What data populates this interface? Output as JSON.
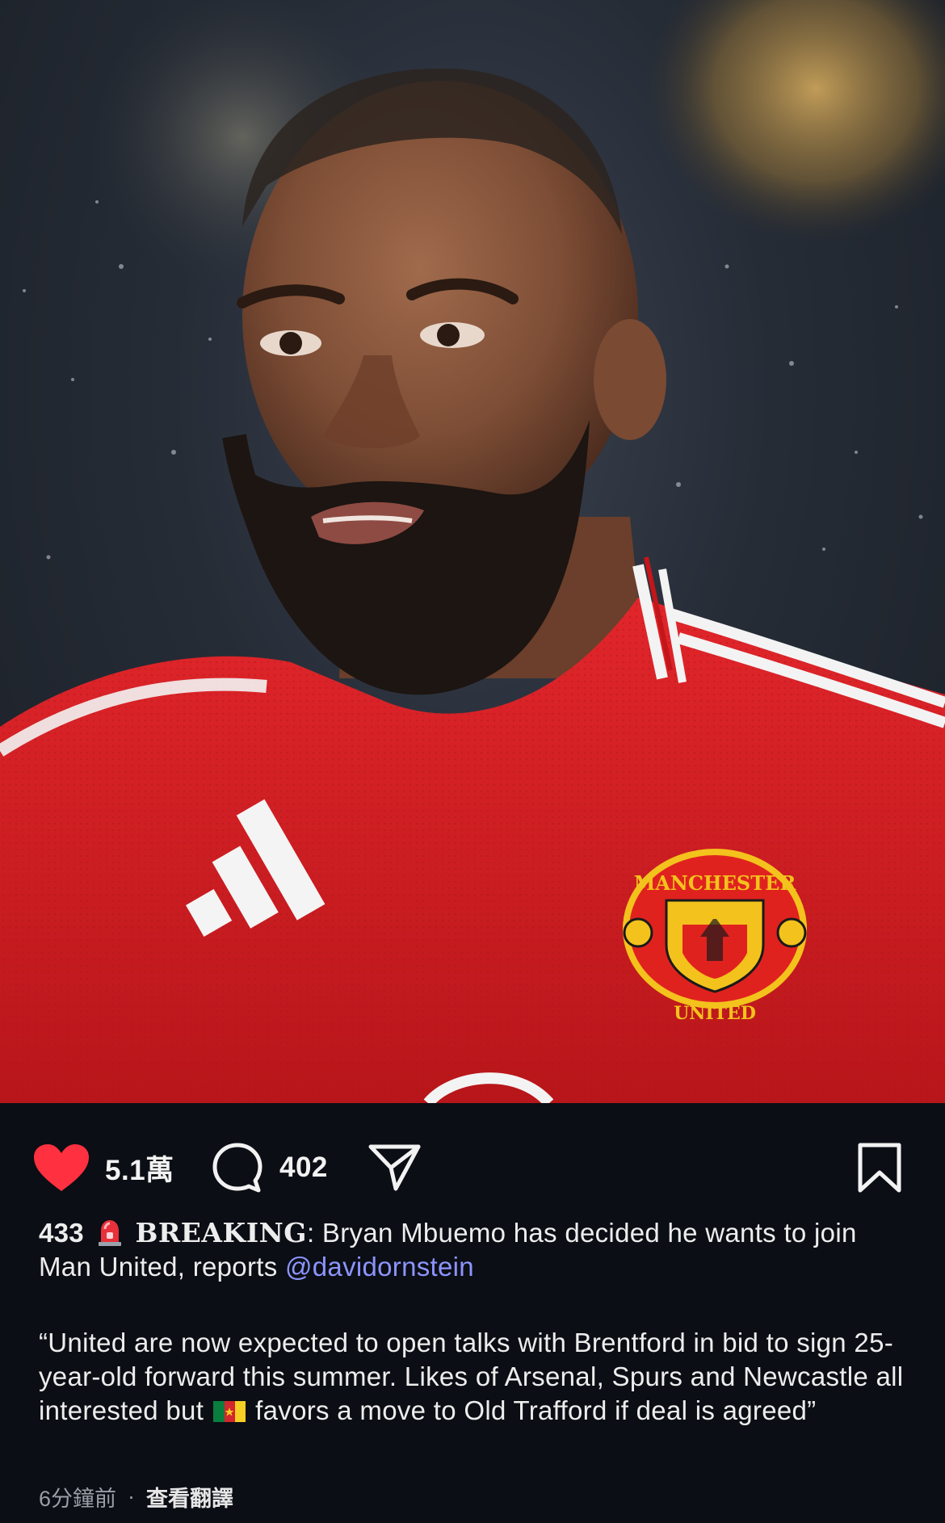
{
  "post": {
    "username": "433",
    "headline": "BREAKING",
    "caption_after_headline": ": Bryan Mbuemo has decided he wants to join Man United, reports ",
    "mention": "@davidornstein",
    "quote_part1": "“United are now expected to open talks with Brentford in bid to sign 25-year-old forward this summer. Likes of Arsenal, Spurs and Newcastle all interested but",
    "quote_part2": "favors a move to Old Trafford if deal is agreed”",
    "time_ago": "6分鐘前",
    "separator": "·",
    "translate_label": "查看翻譯"
  },
  "actions": {
    "likes": "5.1萬",
    "comments": "402",
    "liked": true
  },
  "photo": {
    "crest_top_text": "MANCHESTER",
    "crest_bottom_text": "UNITED"
  },
  "icons": {
    "like": "heart-filled-icon",
    "comment": "speech-bubble-icon",
    "share": "paper-plane-icon",
    "save": "bookmark-icon",
    "siren": "rotating-light-emoji",
    "flag": "cameroon-flag-emoji"
  },
  "colors": {
    "like_red": "#ff3040",
    "mention_blue": "#8c94ff",
    "background": "#0b0e14",
    "jersey_red": "#d31d20"
  }
}
